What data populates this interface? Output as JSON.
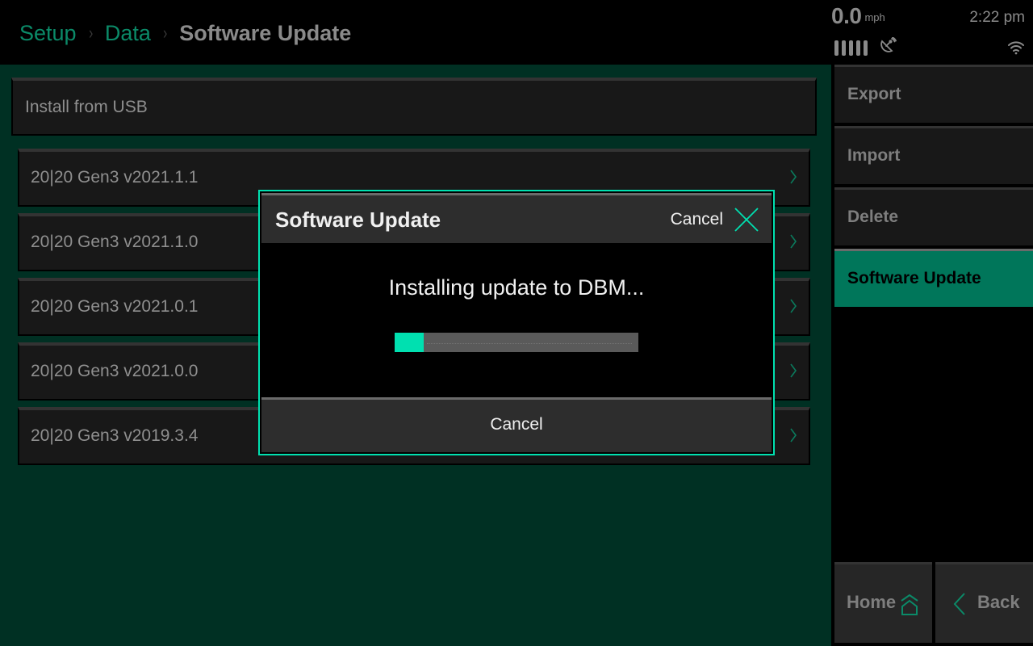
{
  "header": {
    "breadcrumb": [
      {
        "label": "Setup"
      },
      {
        "label": "Data"
      }
    ],
    "current_page": "Software Update",
    "separator": "›"
  },
  "status": {
    "speed_value": "0.0",
    "speed_unit": "mph",
    "time": "2:22 pm",
    "gps_signal_bars": 5,
    "icons": [
      "gps-signal-bars-icon",
      "satellite-dish-icon",
      "wifi-icon"
    ]
  },
  "main": {
    "install_from_usb_label": "Install from USB",
    "versions": [
      {
        "label": "20|20 Gen3 v2021.1.1"
      },
      {
        "label": "20|20 Gen3 v2021.1.0"
      },
      {
        "label": "20|20 Gen3 v2021.0.1"
      },
      {
        "label": "20|20 Gen3 v2021.0.0"
      },
      {
        "label": "20|20 Gen3 v2019.3.4"
      }
    ]
  },
  "sidebar": {
    "items": [
      {
        "label": "Export",
        "active": false
      },
      {
        "label": "Import",
        "active": false
      },
      {
        "label": "Delete",
        "active": false
      },
      {
        "label": "Software Update",
        "active": true
      }
    ],
    "home_label": "Home",
    "back_label": "Back"
  },
  "modal": {
    "title": "Software Update",
    "cancel_top_label": "Cancel",
    "message": "Installing update to DBM...",
    "progress_percent": 12,
    "cancel_bottom_label": "Cancel"
  },
  "colors": {
    "accent": "#00e0b0",
    "brand_green": "#0b8a68",
    "active_item": "#00765a",
    "background_main": "#003023"
  }
}
